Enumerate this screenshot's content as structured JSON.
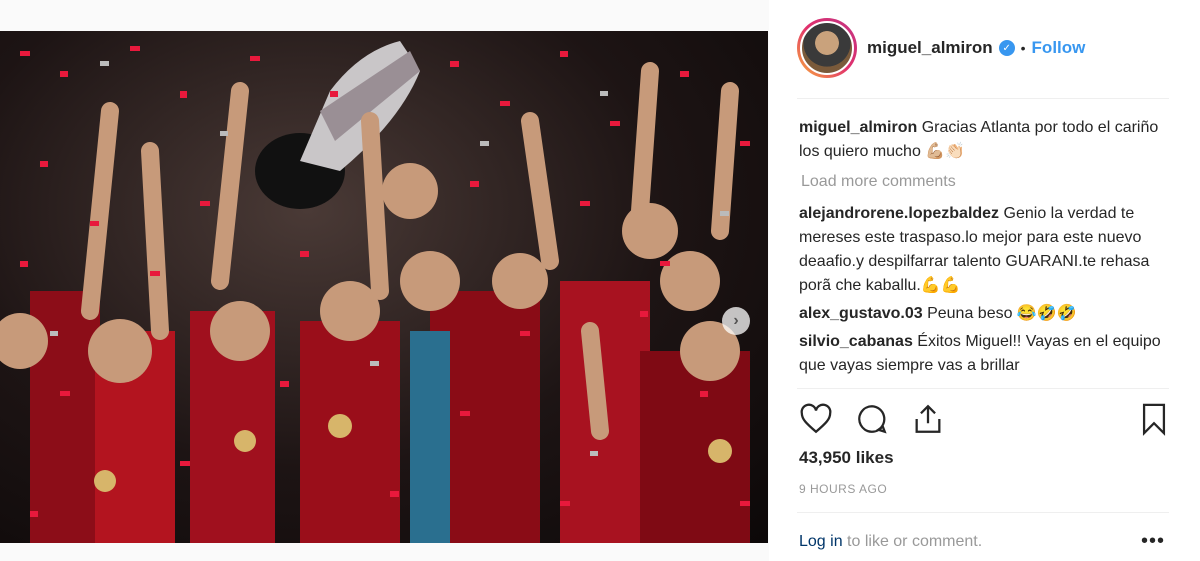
{
  "post": {
    "username": "miguel_almiron",
    "follow_label": "Follow",
    "separator": "•",
    "caption": {
      "user": "miguel_almiron",
      "text": "Gracias Atlanta por todo el cariño los quiero mucho 💪🏼👏🏻"
    },
    "load_more": "Load more comments",
    "comments": [
      {
        "user": "alejandrorene.lopezbaldez",
        "text": "Genio la verdad te mereses este traspaso.lo mejor para este nuevo deaafio.y despilfarrar talento GUARANI.te rehasa porã che kaballu.💪💪"
      },
      {
        "user": "alex_gustavo.03",
        "text": "Peuna beso 😂🤣🤣"
      },
      {
        "user": "silvio_cabanas",
        "text": "Éxitos Miguel!! Vayas en el equipo que vayas siempre vas a brillar"
      }
    ],
    "likes": "43,950 likes",
    "time": "9 HOURS AGO",
    "login_link": "Log in",
    "login_rest": " to like or comment.",
    "more_label": "•••",
    "next_arrow": "›",
    "carousel_count": 6,
    "carousel_active": 1
  },
  "colors": {
    "accent": "#3897f0",
    "confetti": "#e8193c",
    "jersey_red": "#a0101e"
  }
}
